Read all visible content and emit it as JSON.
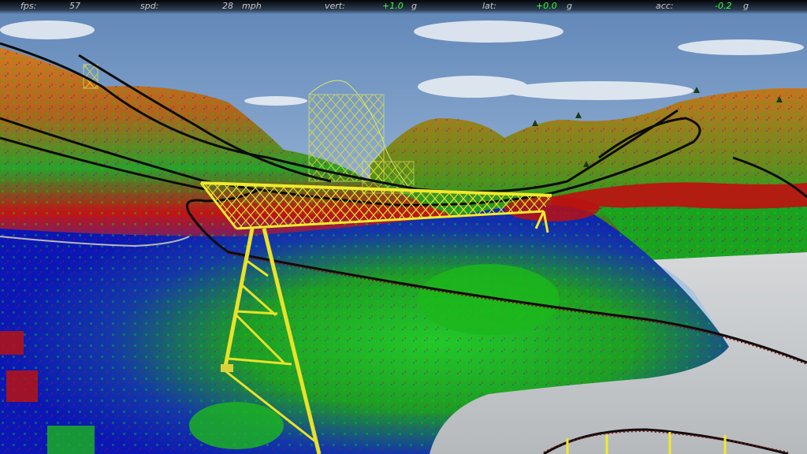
{
  "hud": {
    "fps": {
      "label": "fps:",
      "value": "57"
    },
    "speed": {
      "label": "spd:",
      "value": "28",
      "unit": "mph"
    },
    "vertical": {
      "label": "vert:",
      "value": "+1.0",
      "unit": "g"
    },
    "lateral": {
      "label": "lat:",
      "value": "+0.0",
      "unit": "g"
    },
    "acceleration": {
      "label": "acc:",
      "value": "-0.2",
      "unit": "g"
    }
  },
  "colors": {
    "sky": "#8fb1d8",
    "water": "#cfd2d4",
    "track_support": "#e6e02e",
    "terrain_blue": "#1020c8",
    "terrain_green": "#1fb81f",
    "terrain_red": "#c81414",
    "terrain_orange": "#c8701e",
    "hud_green": "#3cff3c"
  }
}
